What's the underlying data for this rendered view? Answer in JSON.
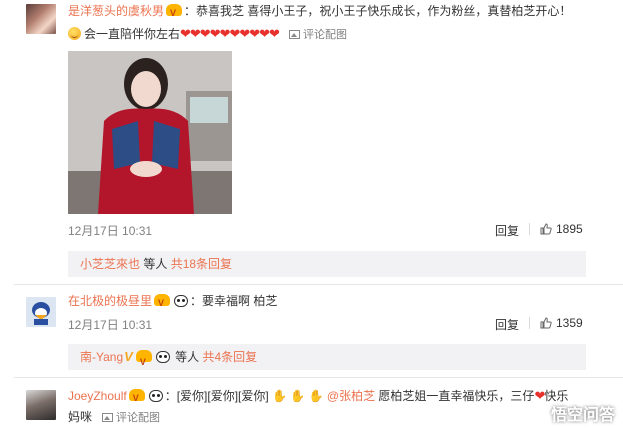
{
  "comments": [
    {
      "user": "是洋葱头的虞秋男",
      "text_line1": "：恭喜我芝 喜得小王子，祝小王子快乐成长，作为粉丝，真替柏芝开心！",
      "text_line2": "会一直陪伴你左右",
      "hearts": "❤❤❤❤❤❤❤❤❤❤",
      "pic_label": "评论配图",
      "time": "12月17日 10:31",
      "reply_label": "回复",
      "likes": "1895",
      "sub_user": "小芝芝來也",
      "sub_mid": " 等人 ",
      "sub_count": "共18条回复"
    },
    {
      "user": "在北极的极昼里",
      "text": "要幸福啊 柏芝",
      "time": "12月17日 10:31",
      "reply_label": "回复",
      "likes": "1359",
      "sub_user": "南-Yang",
      "sub_mid": " 等人 ",
      "sub_count": "共4条回复"
    },
    {
      "user": "JoeyZhoulf",
      "text_pre": "[爱你][爱你][爱你]",
      "mention": "@张柏芝",
      "text_post": " 愿柏芝姐一直幸福快乐，三仔",
      "text_end": "快乐",
      "text_line2": "妈咪",
      "pic_label": "评论配图"
    }
  ],
  "watermark": "悟空问答",
  "colors": {
    "username": "#eb7350",
    "heart": "#e8312d",
    "meta": "#808080",
    "subreply_bg": "#f2f2f5"
  },
  "icons": [
    "face-smile-icon",
    "heart-icon",
    "picture-icon",
    "thumb-up-icon",
    "vip-badge-icon",
    "panda-icon"
  ]
}
